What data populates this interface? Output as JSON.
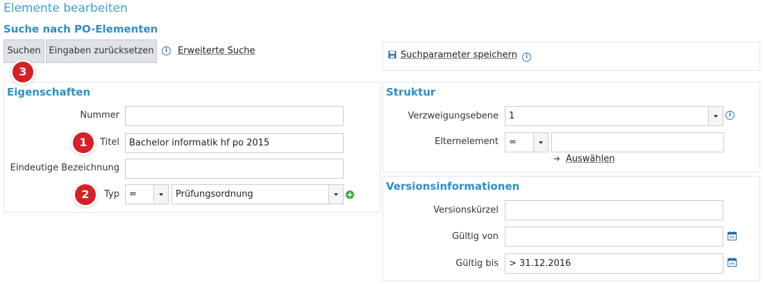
{
  "page": {
    "title": "Elemente bearbeiten",
    "section_title": "Suche nach PO-Elementen"
  },
  "toolbar": {
    "search_label": "Suchen",
    "reset_label": "Eingaben zurücksetzen",
    "advanced_search_label": "Erweiterte Suche",
    "info_icon": "info-icon"
  },
  "save_params": {
    "label": "Suchparameter speichern",
    "icon": "save-icon"
  },
  "badges": {
    "one": "1",
    "two": "2",
    "three": "3",
    "color": "#d42027"
  },
  "eigenschaften": {
    "title": "Eigenschaften",
    "nummer_label": "Nummer",
    "nummer_value": "",
    "titel_label": "Titel",
    "titel_value": "Bachelor informatik hf po 2015",
    "bezeichnung_label": "Eindeutige Bezeichnung",
    "bezeichnung_value": "",
    "typ_label": "Typ",
    "typ_operator": "=",
    "typ_value": "Prüfungsordnung"
  },
  "struktur": {
    "title": "Struktur",
    "ebene_label": "Verzweigungsebene",
    "ebene_value": "1",
    "eltern_label": "Elternelement",
    "eltern_operator": "=",
    "eltern_value": "",
    "auswaehlen_label": "Auswählen"
  },
  "versionsinfo": {
    "title": "Versionsinformationen",
    "kuerzel_label": "Versionskürzel",
    "kuerzel_value": "",
    "von_label": "Gültig von",
    "von_value": "",
    "bis_label": "Gültig bis",
    "bis_value": "> 31.12.2016"
  },
  "colors": {
    "accent": "#2c8fc9",
    "button_bg": "#dfe3e7",
    "plus_green": "#3aa43a"
  }
}
